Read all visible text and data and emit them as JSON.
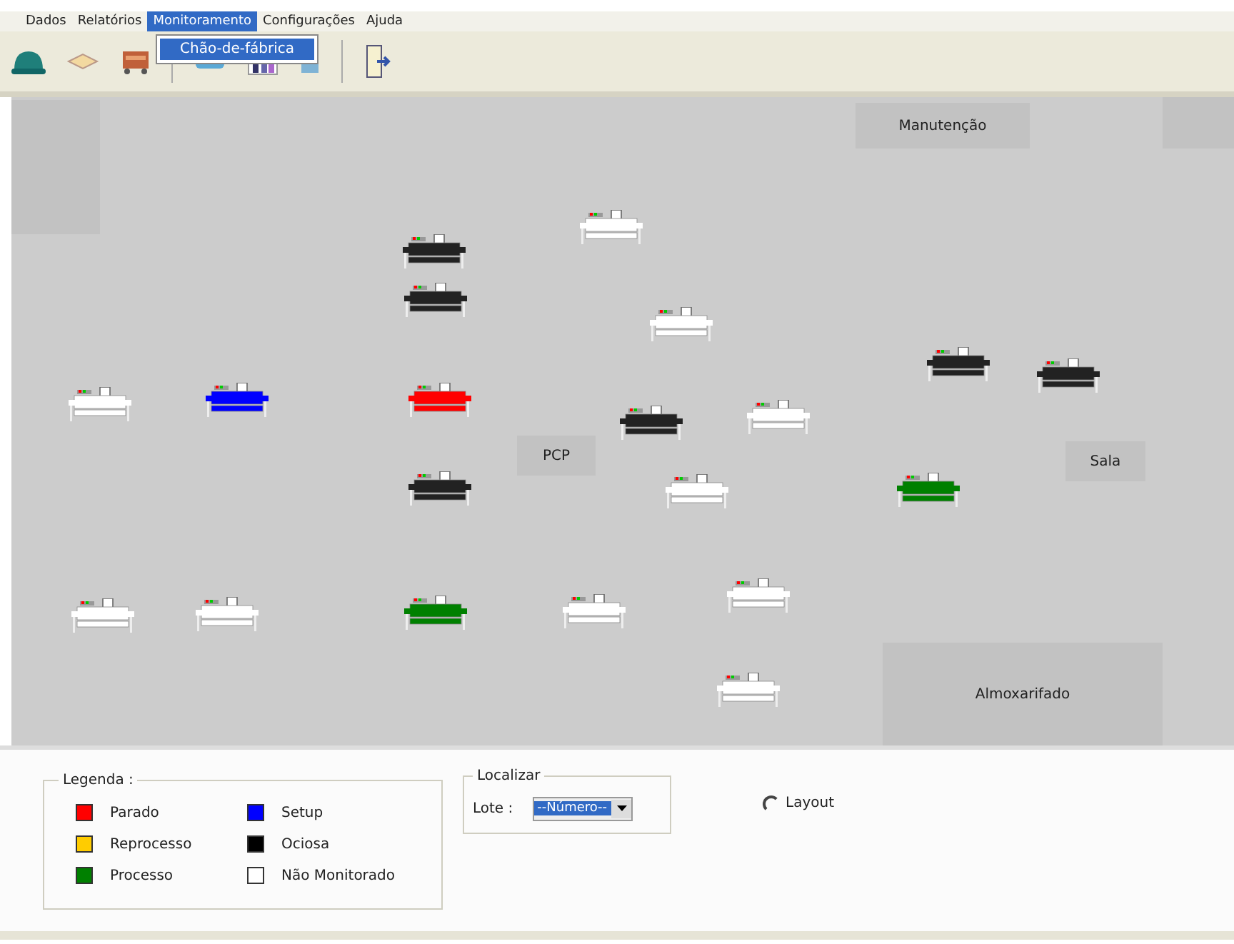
{
  "menu": [
    {
      "label": "Dados",
      "selected": false
    },
    {
      "label": "Relatórios",
      "selected": false
    },
    {
      "label": "Monitoramento",
      "selected": true
    },
    {
      "label": "Configurações",
      "selected": false
    },
    {
      "label": "Ajuda",
      "selected": false
    }
  ],
  "dropdown": {
    "items": [
      "Chão-de-fábrica"
    ]
  },
  "floor": {
    "rooms": [
      {
        "kind": "room",
        "label": "Manutenção"
      },
      {
        "kind": "block"
      },
      {
        "kind": "block"
      },
      {
        "kind": "room",
        "label": "PCP"
      },
      {
        "kind": "room",
        "label": "Sala"
      },
      {
        "kind": "room",
        "label": "Almoxarifado"
      }
    ],
    "machines": [
      {
        "color": "#222222"
      },
      {
        "color": "#222222"
      },
      {
        "color": "#ffffff"
      },
      {
        "color": "#ffffff"
      },
      {
        "color": "#222222"
      },
      {
        "color": "#222222"
      },
      {
        "color": "#ffffff"
      },
      {
        "color": "#0000ff"
      },
      {
        "color": "#ff0000"
      },
      {
        "color": "#222222"
      },
      {
        "color": "#ffffff"
      },
      {
        "color": "#222222"
      },
      {
        "color": "#ffffff"
      },
      {
        "color": "#008000"
      },
      {
        "color": "#ffffff"
      },
      {
        "color": "#ffffff"
      },
      {
        "color": "#008000"
      },
      {
        "color": "#ffffff"
      },
      {
        "color": "#ffffff"
      },
      {
        "color": "#ffffff"
      }
    ]
  },
  "legend": {
    "title": "Legenda :",
    "items": [
      {
        "label": "Parado",
        "color": "#ff0000"
      },
      {
        "label": "Reprocesso",
        "color": "#ffcc00"
      },
      {
        "label": "Processo",
        "color": "#008000"
      },
      {
        "label": "Setup",
        "color": "#0000ff"
      },
      {
        "label": "Ociosa",
        "color": "#000000"
      },
      {
        "label": "Não Monitorado",
        "color": "#ffffff"
      }
    ]
  },
  "localizar": {
    "title": "Localizar",
    "label": "Lote :",
    "value": "--Número--"
  },
  "layout_option": {
    "label": "Layout",
    "checked": false
  }
}
